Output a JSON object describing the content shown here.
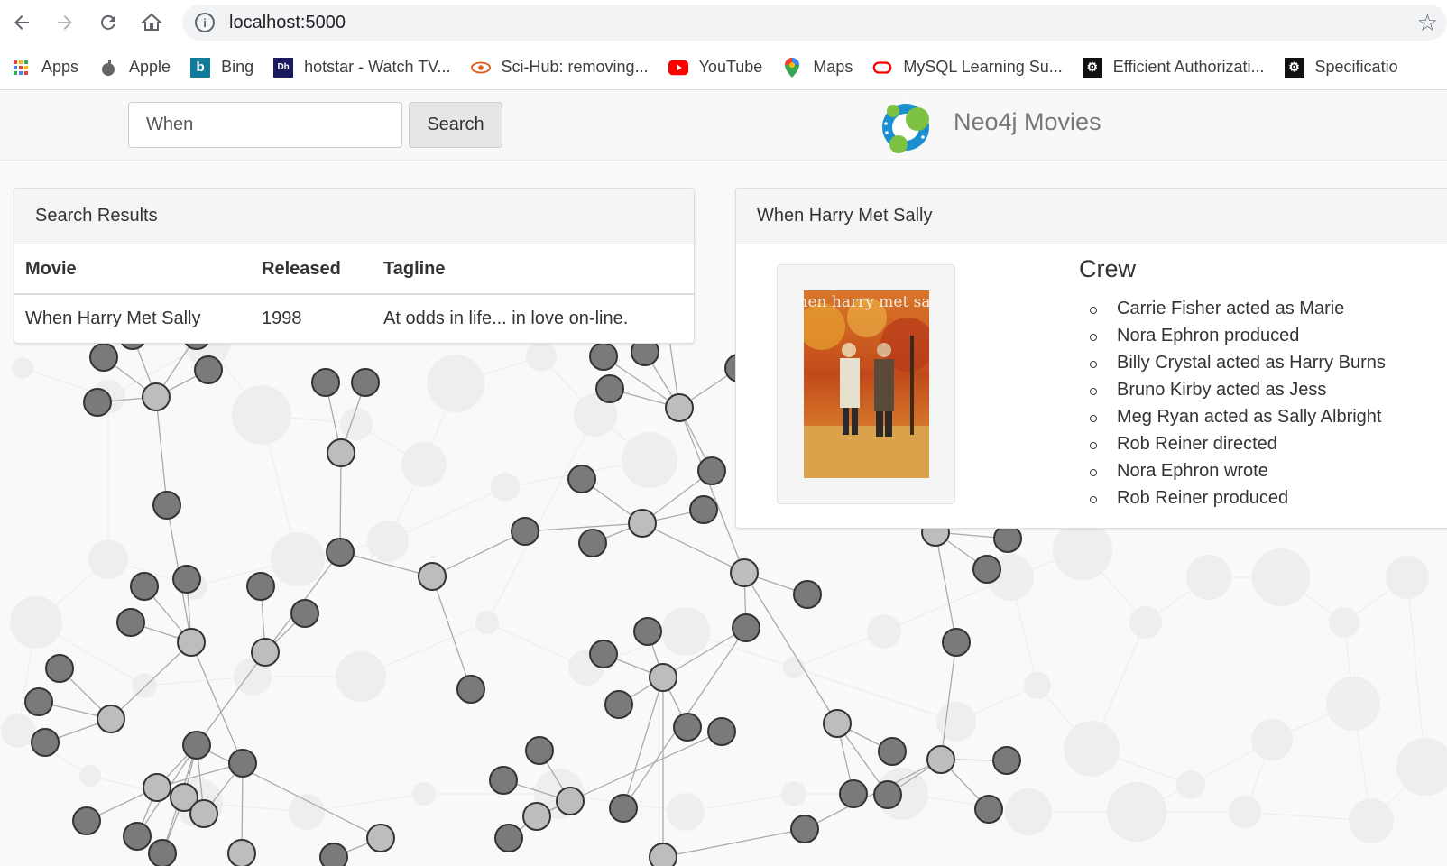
{
  "browser": {
    "url": "localhost:5000",
    "bookmarks": [
      {
        "label": "Apps",
        "icon": "apps-grid-icon"
      },
      {
        "label": "Apple",
        "icon": "apple-icon"
      },
      {
        "label": "Bing",
        "icon": "bing-icon"
      },
      {
        "label": "hotstar - Watch TV...",
        "icon": "hotstar-icon"
      },
      {
        "label": "Sci-Hub: removing...",
        "icon": "scihub-icon"
      },
      {
        "label": "YouTube",
        "icon": "youtube-icon"
      },
      {
        "label": "Maps",
        "icon": "maps-pin-icon"
      },
      {
        "label": "MySQL Learning Su...",
        "icon": "oracle-icon"
      },
      {
        "label": "Efficient Authorizati...",
        "icon": "settings-badge-icon"
      },
      {
        "label": "Specificatio",
        "icon": "settings-badge-icon"
      }
    ]
  },
  "app": {
    "search_value": "When",
    "search_button": "Search",
    "brand": "Neo4j Movies",
    "brand_colors": {
      "blue": "#1b8fd0",
      "green": "#7cc142"
    }
  },
  "results": {
    "heading": "Search Results",
    "columns": [
      "Movie",
      "Released",
      "Tagline"
    ],
    "rows": [
      {
        "movie": "When Harry Met Sally",
        "released": "1998",
        "tagline": "At odds in life... in love on-line."
      }
    ]
  },
  "details": {
    "heading": "When Harry Met Sally",
    "poster_text": "when harry met sally",
    "crew_heading": "Crew",
    "crew": [
      "Carrie Fisher acted as Marie",
      "Nora Ephron produced",
      "Billy Crystal acted as Harry Burns",
      "Bruno Kirby acted as Jess",
      "Meg Ryan acted as Sally Albright",
      "Rob Reiner directed",
      "Nora Ephron wrote",
      "Rob Reiner produced"
    ]
  },
  "graph": {
    "node_colors": {
      "movie": "#bdbdbd",
      "person": "#7a7a7a",
      "stroke": "#333333",
      "link": "#aaaaaa",
      "background_node": "#eeeeee"
    }
  }
}
